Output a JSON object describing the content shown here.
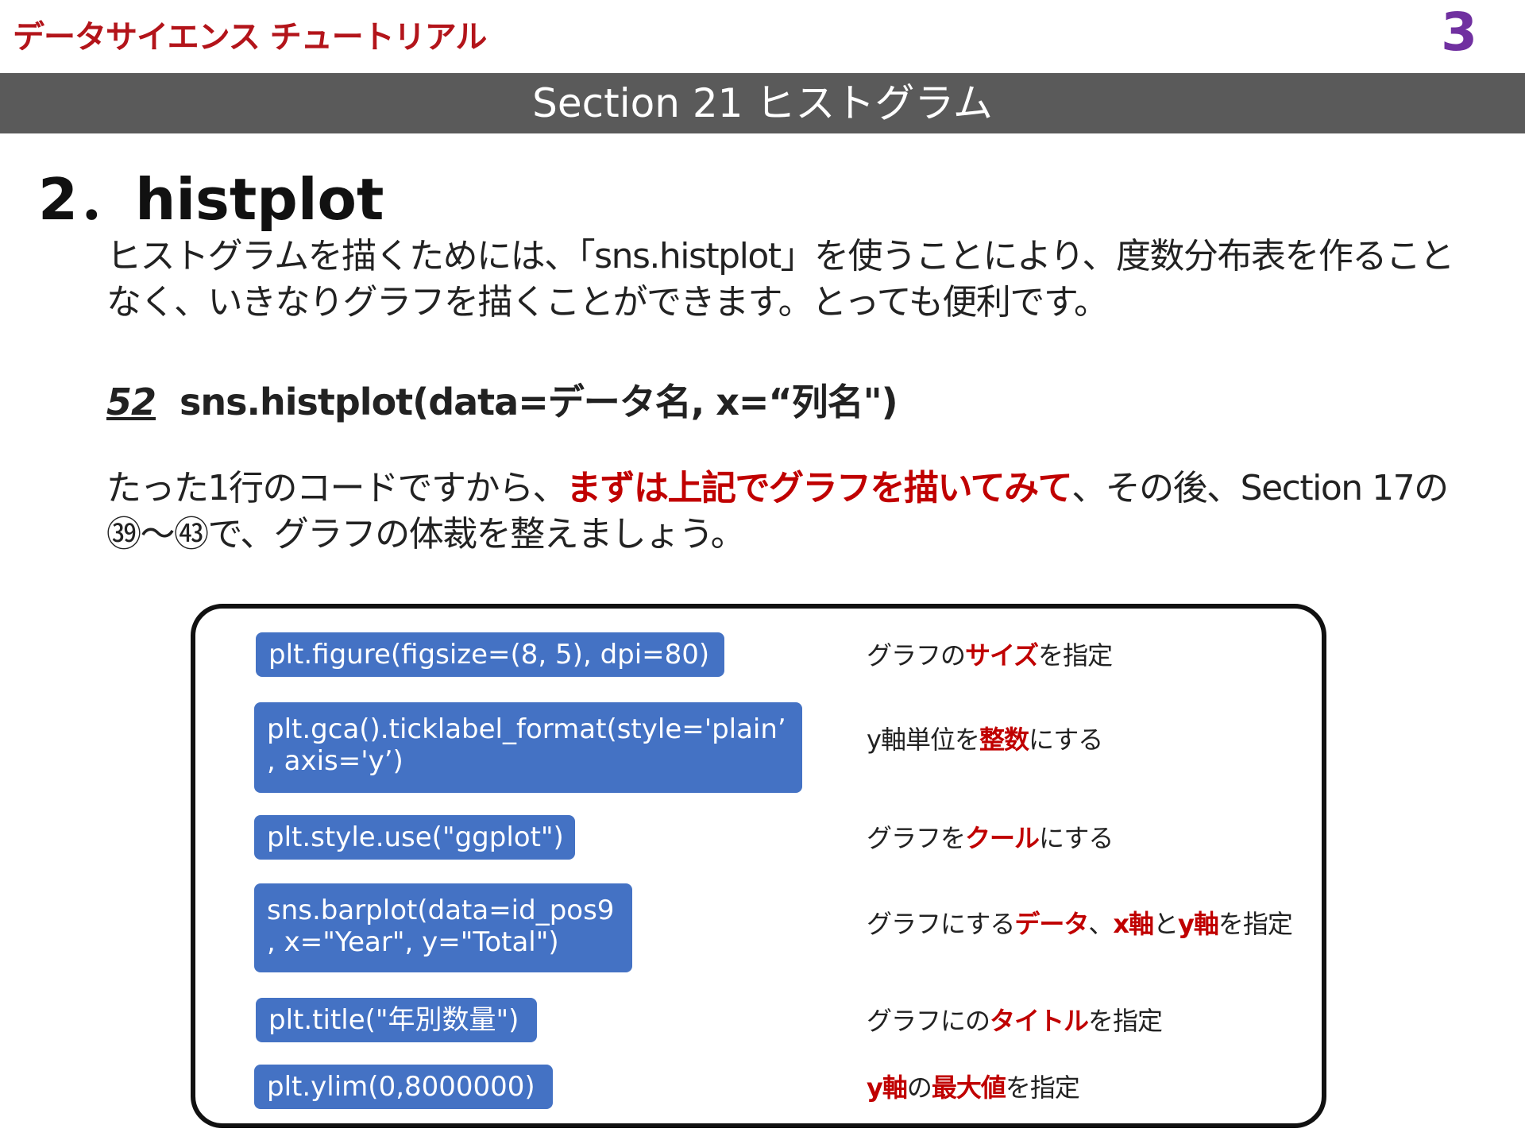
{
  "header": {
    "brand": "データサイエンス チュートリアル",
    "page_number": "3",
    "section": "Section 21 ヒストグラム"
  },
  "title": "2．histplot",
  "intro": "ヒストグラムを描くためには、「sns.histplot」を使うことにより、度数分布表を作ることなく、いきなりグラフを描くことができます。とっても便利です。",
  "syntax": {
    "number": "52",
    "code": "sns.histplot(data=データ名, x=“列名\")"
  },
  "advice": {
    "before": "たった1行のコードですから、",
    "emphasis": "まずは上記でグラフを描いてみて",
    "after": "、その後、Section 17の㊴～㊸で、グラフの体裁を整えましょう。"
  },
  "steps": [
    {
      "code_lines": [
        "plt.figure(figsize=(8, 5), dpi=80)"
      ],
      "desc": [
        {
          "text": "グラフの",
          "red": false
        },
        {
          "text": "サイズ",
          "red": true
        },
        {
          "text": "を指定",
          "red": false
        }
      ]
    },
    {
      "code_lines": [
        "plt.gca().ticklabel_format(style='plain’",
        ", axis='y’)"
      ],
      "desc": [
        {
          "text": "y軸単位を",
          "red": false
        },
        {
          "text": "整数",
          "red": true
        },
        {
          "text": "にする",
          "red": false
        }
      ]
    },
    {
      "code_lines": [
        "plt.style.use(\"ggplot\")"
      ],
      "desc": [
        {
          "text": "グラフを",
          "red": false
        },
        {
          "text": "クール",
          "red": true
        },
        {
          "text": "にする",
          "red": false
        }
      ]
    },
    {
      "code_lines": [
        "sns.barplot(data=id_pos9",
        ", x=\"Year\", y=\"Total\")"
      ],
      "desc": [
        {
          "text": "グラフにする",
          "red": false
        },
        {
          "text": "データ",
          "red": true
        },
        {
          "text": "、",
          "red": false
        },
        {
          "text": "x軸",
          "red": true
        },
        {
          "text": "と",
          "red": false
        },
        {
          "text": "y軸",
          "red": true
        },
        {
          "text": "を指定",
          "red": false
        }
      ]
    },
    {
      "code_lines": [
        "plt.title(\"年別数量\")"
      ],
      "desc": [
        {
          "text": "グラフにの",
          "red": false
        },
        {
          "text": "タイトル",
          "red": true
        },
        {
          "text": "を指定",
          "red": false
        }
      ]
    },
    {
      "code_lines": [
        "plt.ylim(0,8000000)"
      ],
      "desc": [
        {
          "text": "y軸",
          "red": true
        },
        {
          "text": "の",
          "red": false
        },
        {
          "text": "最大値",
          "red": true
        },
        {
          "text": "を指定",
          "red": false
        }
      ]
    }
  ]
}
